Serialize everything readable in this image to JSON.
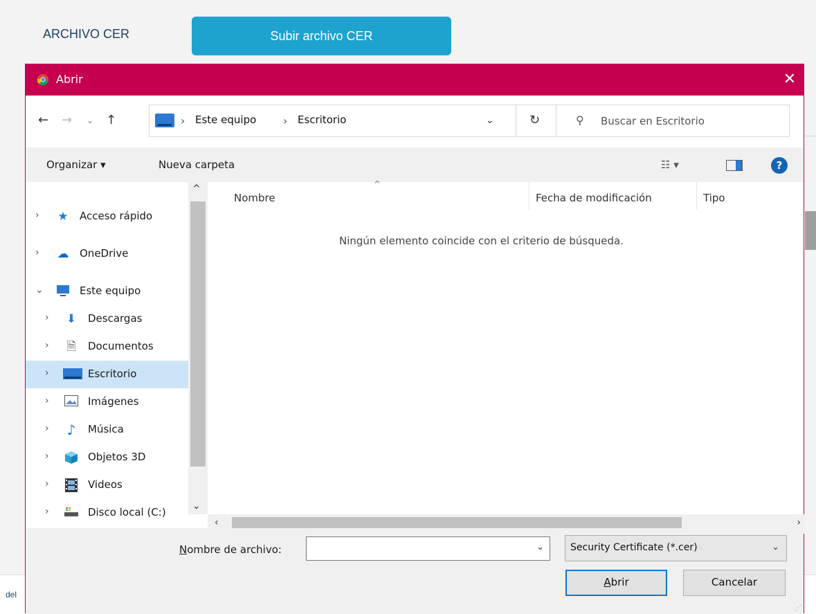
{
  "page": {
    "cer_label": "ARCHIVO CER",
    "upload_button": "Subir archivo CER",
    "footer_fragment": "del"
  },
  "dialog": {
    "title": "Abrir",
    "title_bar_color": "#c5004f",
    "breadcrumb": [
      "Este equipo",
      "Escritorio"
    ],
    "search_placeholder": "Buscar en Escritorio",
    "toolbar": {
      "organize": "Organizar ▾",
      "new_folder": "Nueva carpeta"
    },
    "nav_items": [
      {
        "label": "Acceso rápido",
        "icon": "star-icon"
      },
      {
        "label": "OneDrive",
        "icon": "cloud-icon"
      },
      {
        "label": "Este equipo",
        "icon": "computer-icon"
      },
      {
        "label": "Descargas",
        "icon": "download-icon"
      },
      {
        "label": "Documentos",
        "icon": "document-icon"
      },
      {
        "label": "Escritorio",
        "icon": "desktop-icon"
      },
      {
        "label": "Imágenes",
        "icon": "image-icon"
      },
      {
        "label": "Música",
        "icon": "music-icon"
      },
      {
        "label": "Objetos 3D",
        "icon": "cube-icon"
      },
      {
        "label": "Videos",
        "icon": "film-icon"
      },
      {
        "label": "Disco local (C:)",
        "icon": "drive-icon"
      }
    ],
    "columns": {
      "name": "Nombre",
      "modified": "Fecha de modificación",
      "type": "Tipo"
    },
    "empty_message": "Ningún elemento coincide con el criterio de búsqueda.",
    "filename_label_first": "N",
    "filename_label_rest": "ombre de archivo:",
    "filename_value": "",
    "filter": "Security Certificate (*.cer)",
    "open_first": "A",
    "open_rest": "brir",
    "cancel": "Cancelar"
  }
}
